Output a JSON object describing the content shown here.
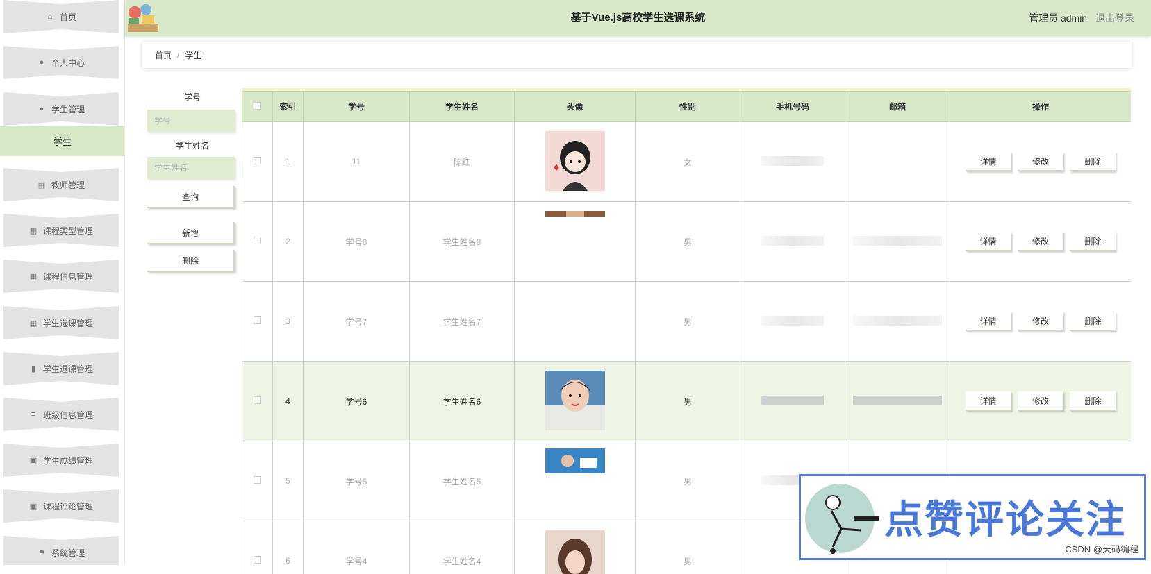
{
  "sidebar": {
    "items": [
      {
        "label": "首页",
        "icon": "home-icon"
      },
      {
        "label": "个人中心",
        "icon": "user-icon"
      },
      {
        "label": "学生管理",
        "icon": "user-icon"
      },
      {
        "label": "教师管理",
        "icon": "grid-icon"
      },
      {
        "label": "课程类型管理",
        "icon": "grid-icon"
      },
      {
        "label": "课程信息管理",
        "icon": "grid-icon"
      },
      {
        "label": "学生选课管理",
        "icon": "grid-icon"
      },
      {
        "label": "学生退课管理",
        "icon": "bar-chart-icon"
      },
      {
        "label": "班级信息管理",
        "icon": "list-icon"
      },
      {
        "label": "学生成绩管理",
        "icon": "clipboard-icon"
      },
      {
        "label": "课程评论管理",
        "icon": "clipboard-check-icon"
      },
      {
        "label": "系统管理",
        "icon": "flag-icon"
      }
    ],
    "active_sub": "学生"
  },
  "header": {
    "title": "基于Vue.js高校学生选课系统",
    "user": "管理员 admin",
    "logout": "退出登录"
  },
  "breadcrumb": {
    "home": "首页",
    "sep": "/",
    "current": "学生"
  },
  "search": {
    "label1": "学号",
    "placeholder1": "学号",
    "label2": "学生姓名",
    "placeholder2": "学生姓名",
    "query": "查询",
    "add": "新增",
    "delete": "删除"
  },
  "table": {
    "headers": [
      "索引",
      "学号",
      "学生姓名",
      "头像",
      "性别",
      "手机号码",
      "邮箱",
      "操作"
    ],
    "rows": [
      {
        "index": "1",
        "id": "11",
        "name": "陈红",
        "gender": "女",
        "avatar": "girl-cartoon"
      },
      {
        "index": "2",
        "id": "学号8",
        "name": "学生姓名8",
        "gender": "男",
        "avatar": "partial"
      },
      {
        "index": "3",
        "id": "学号7",
        "name": "学生姓名7",
        "gender": "男",
        "avatar": "none"
      },
      {
        "index": "4",
        "id": "学号6",
        "name": "学生姓名6",
        "gender": "男",
        "avatar": "boy-photo"
      },
      {
        "index": "5",
        "id": "学号5",
        "name": "学生姓名5",
        "gender": "男",
        "avatar": "partial-blue"
      },
      {
        "index": "6",
        "id": "学号4",
        "name": "学生姓名4",
        "gender": "男",
        "avatar": "girl-photo"
      }
    ],
    "actions": [
      "详情",
      "修改",
      "删除"
    ]
  },
  "overlay": {
    "promo_text": "点赞评论关注",
    "csdn": "CSDN @天码编程"
  }
}
